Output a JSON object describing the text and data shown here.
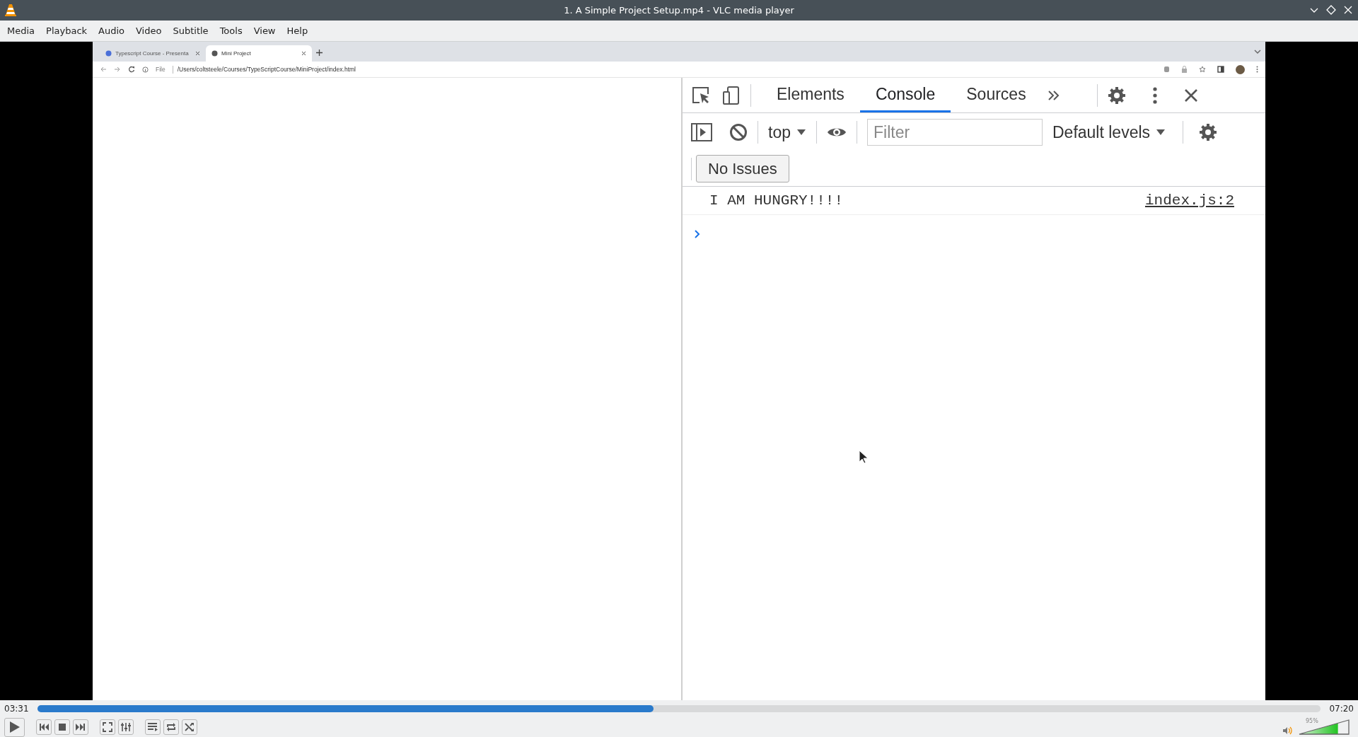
{
  "window": {
    "title": "1. A Simple Project Setup.mp4 - VLC media player"
  },
  "menu": [
    "Media",
    "Playback",
    "Audio",
    "Video",
    "Subtitle",
    "Tools",
    "View",
    "Help"
  ],
  "video": {
    "browser": {
      "tabs": [
        {
          "label": "Typescript Course - Presenta",
          "selected": false
        },
        {
          "label": "Mini Project",
          "selected": true
        }
      ],
      "address": {
        "scheme": "File",
        "url": "/Users/coltsteele/Courses/TypeScriptCourse/MiniProject/index.html"
      }
    },
    "devtools": {
      "tabs": [
        {
          "label": "Elements",
          "selected": false
        },
        {
          "label": "Console",
          "selected": true
        },
        {
          "label": "Sources",
          "selected": false
        }
      ],
      "context": "top",
      "filter": {
        "placeholder": "Filter"
      },
      "levels": "Default levels",
      "issues": "No Issues",
      "messages": [
        {
          "text": "I AM HUNGRY!!!!",
          "source": "index.js:2"
        }
      ]
    }
  },
  "player": {
    "elapsed": "03:31",
    "total": "07:20",
    "progress": {
      "level": 0.48
    },
    "playing": false,
    "volume": {
      "level": 0.78,
      "reading": "95%"
    }
  }
}
